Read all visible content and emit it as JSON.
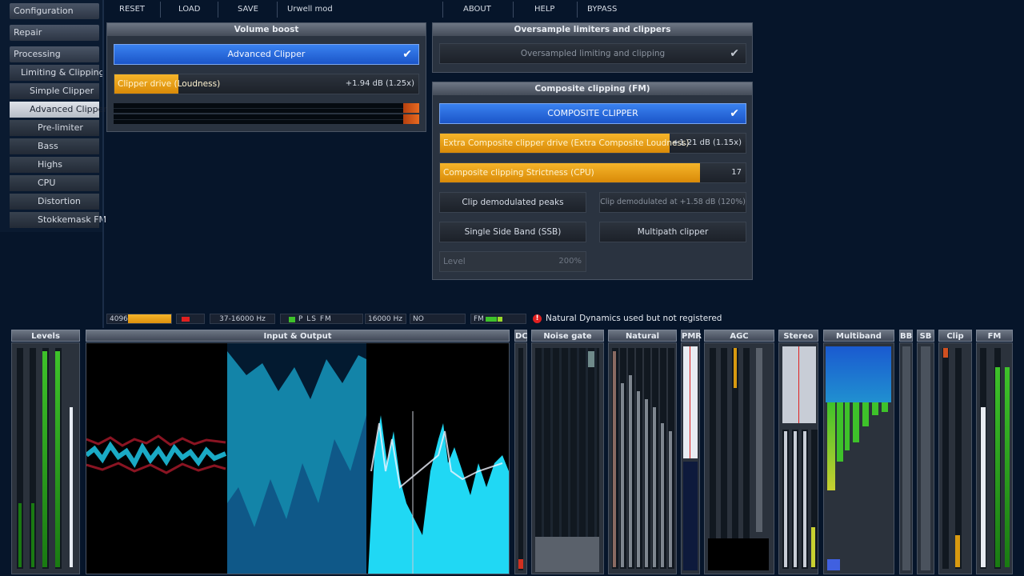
{
  "sidebar": {
    "items": [
      {
        "label": "Configuration"
      },
      {
        "label": "Repair"
      },
      {
        "label": "Processing"
      },
      {
        "label": "Limiting & Clipping"
      },
      {
        "label": "Simple Clipper"
      },
      {
        "label": "Advanced Clipper"
      },
      {
        "label": "Pre-limiter"
      },
      {
        "label": "Bass"
      },
      {
        "label": "Highs"
      },
      {
        "label": "CPU"
      },
      {
        "label": "Distortion"
      },
      {
        "label": "Stokkemask FM"
      }
    ],
    "active": "Advanced Clipper"
  },
  "toolbar": {
    "reset": "RESET",
    "load": "LOAD",
    "save": "SAVE",
    "preset": "Urwell mod",
    "about": "ABOUT",
    "help": "HELP",
    "bypass": "BYPASS"
  },
  "volume_boost": {
    "title": "Volume boost",
    "advanced_clipper": {
      "label": "Advanced Clipper",
      "checked": true
    },
    "clipper_drive": {
      "label": "Clipper drive (Loudness)",
      "value": "+1.94 dB (1.25x)",
      "level": 0.21
    }
  },
  "oversample": {
    "title": "Oversample limiters and clippers",
    "toggle": {
      "label": "Oversampled limiting and clipping",
      "checked": true
    }
  },
  "composite": {
    "title": "Composite clipping (FM)",
    "composite_clipper": {
      "label": "COMPOSITE CLIPPER",
      "checked": true
    },
    "extra_drive": {
      "label": "Extra Composite clipper drive (Extra Composite Loudness)",
      "value": "+1.21 dB (1.15x)",
      "level": 0.75
    },
    "strictness": {
      "label": "Composite clipping Strictness (CPU)",
      "value": "17",
      "level": 0.85
    },
    "clip_peaks": {
      "label": "Clip demodulated peaks"
    },
    "clip_at": {
      "label": "Clip demodulated at +1.58 dB (120%)"
    },
    "ssb": {
      "label": "Single Side Band (SSB)"
    },
    "multipath": {
      "label": "Multipath clipper"
    },
    "level": {
      "label": "Level",
      "value": "200%"
    }
  },
  "status": {
    "buffer": "4096",
    "bandwidth": "37-16000 Hz",
    "modes": "P  LS  FM",
    "lowpass": "16000 Hz",
    "no": "NO",
    "fm": "FM",
    "warning": "Natural Dynamics used but not registered"
  },
  "meters": {
    "levels": "Levels",
    "io": "Input & Output",
    "dc": "DC",
    "noise_gate": "Noise gate",
    "natural": "Natural",
    "pmr": "PMR",
    "agc": "AGC",
    "stereo": "Stereo",
    "multiband": "Multiband",
    "bb": "BB",
    "sb": "SB",
    "clip": "Clip",
    "fm": "FM"
  },
  "colors": {
    "accent_blue": "#2a6ae0",
    "slider_orange": "#f0a820",
    "meter_green": "#3ec22a",
    "spectrum_cyan": "#1ec8e8",
    "warning_red": "#e02020"
  }
}
